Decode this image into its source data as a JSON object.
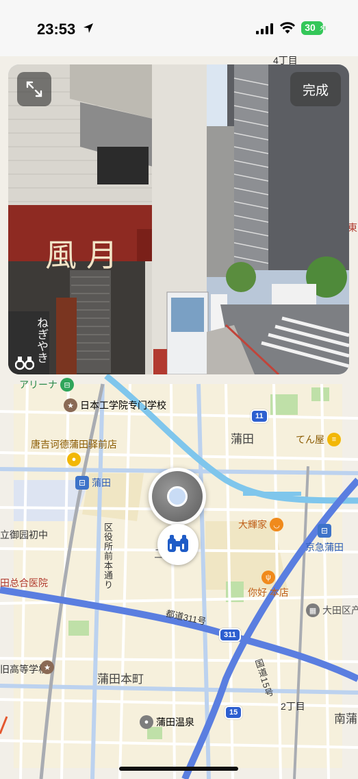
{
  "status_bar": {
    "time": "23:53",
    "battery": "30"
  },
  "street_view": {
    "done_label": "完成",
    "shop_sign": "風月",
    "side_sign": "ねぎやき"
  },
  "map": {
    "labels": {
      "chome4": "4丁目",
      "chome2": "2丁目",
      "higashi": "東",
      "kamata": "蒲田",
      "kamata_honcho": "蒲田本町",
      "minami": "南蒲",
      "kuyakusho": "区役所前本通り",
      "toudou": "都道311号",
      "kokudo": "国道15号",
      "ni": "二",
      "goyen": "立御园初中",
      "hospital": "田总合医院",
      "kougakkou": "旧高等学校"
    },
    "poi": {
      "arena": "アリーナ",
      "nihon_kougakuin": "日本工学院专门学校",
      "donki": "唐吉诃德蒲田驿前店",
      "tenya": "てん屋",
      "kamata_station": "蒲田",
      "taikiya": "大輝家",
      "keikyu": "京急蒲田",
      "nihao": "你好 本店",
      "ota_ku": "大田区产",
      "kamata_onsen": "蒲田温泉"
    },
    "shields": {
      "r11": "11",
      "r311": "311",
      "r15": "15"
    }
  }
}
